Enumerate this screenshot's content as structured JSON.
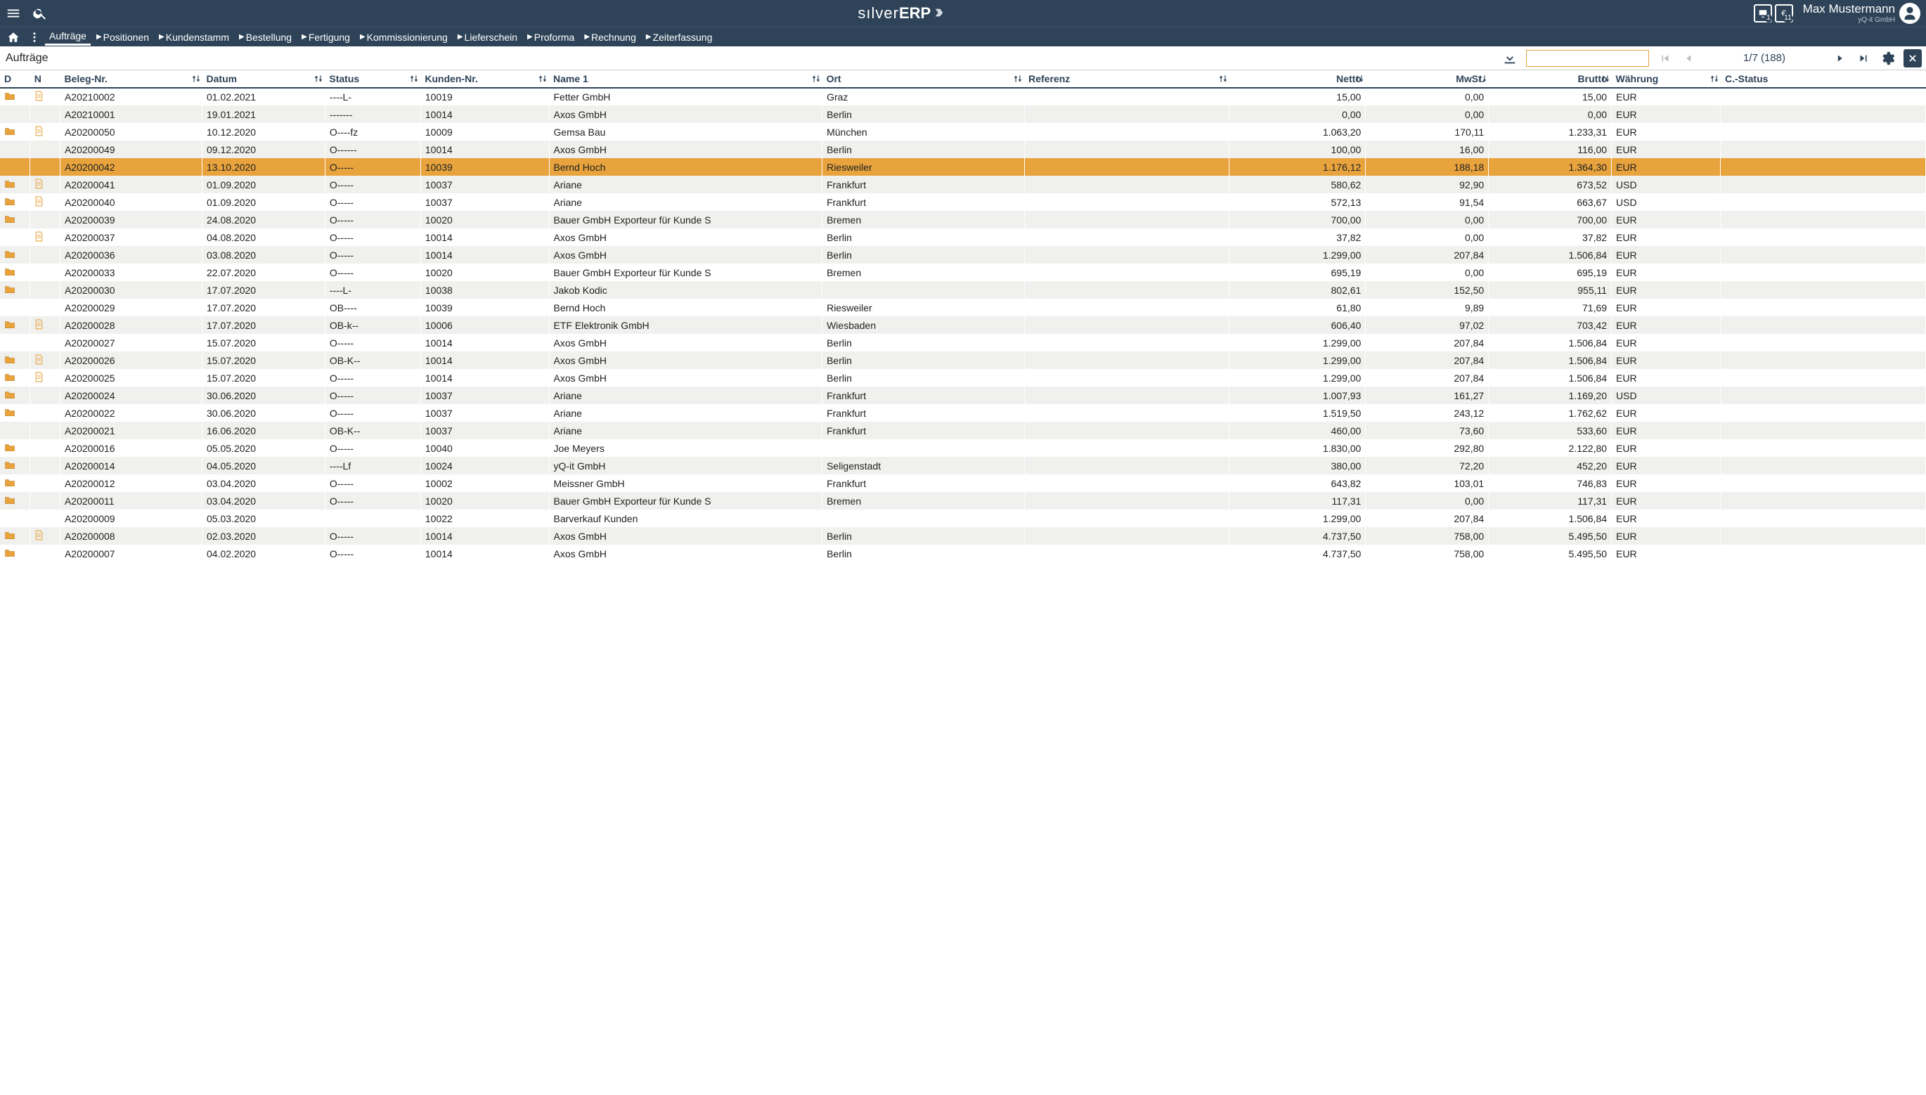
{
  "header": {
    "app_name_light": "sılver",
    "app_name_bold": "ERP",
    "badge1_count": "1",
    "badge2_count": "11",
    "user_name": "Max Mustermann",
    "user_company": "yQ-it GmbH"
  },
  "breadcrumb": {
    "items": [
      {
        "label": "Aufträge",
        "active": true,
        "caret": false
      },
      {
        "label": "Positionen",
        "active": false,
        "caret": true
      },
      {
        "label": "Kundenstamm",
        "active": false,
        "caret": true
      },
      {
        "label": "Bestellung",
        "active": false,
        "caret": true
      },
      {
        "label": "Fertigung",
        "active": false,
        "caret": true
      },
      {
        "label": "Kommissionierung",
        "active": false,
        "caret": true
      },
      {
        "label": "Lieferschein",
        "active": false,
        "caret": true
      },
      {
        "label": "Proforma",
        "active": false,
        "caret": true
      },
      {
        "label": "Rechnung",
        "active": false,
        "caret": true
      },
      {
        "label": "Zeiterfassung",
        "active": false,
        "caret": true
      }
    ]
  },
  "toolbar": {
    "title": "Aufträge",
    "search_value": "",
    "search_placeholder": "",
    "pager": "1/7 (188)"
  },
  "table": {
    "columns": [
      {
        "key": "d",
        "label": "D",
        "num": false,
        "sort": false
      },
      {
        "key": "n",
        "label": "N",
        "num": false,
        "sort": false
      },
      {
        "key": "beleg",
        "label": "Beleg-Nr.",
        "num": false,
        "sort": true
      },
      {
        "key": "datum",
        "label": "Datum",
        "num": false,
        "sort": true
      },
      {
        "key": "status",
        "label": "Status",
        "num": false,
        "sort": true
      },
      {
        "key": "kunden",
        "label": "Kunden-Nr.",
        "num": false,
        "sort": true
      },
      {
        "key": "name1",
        "label": "Name 1",
        "num": false,
        "sort": true
      },
      {
        "key": "ort",
        "label": "Ort",
        "num": false,
        "sort": true
      },
      {
        "key": "referenz",
        "label": "Referenz",
        "num": false,
        "sort": true
      },
      {
        "key": "netto",
        "label": "Netto",
        "num": true,
        "sort": true
      },
      {
        "key": "mwst",
        "label": "MwSt.",
        "num": true,
        "sort": true
      },
      {
        "key": "brutto",
        "label": "Brutto",
        "num": true,
        "sort": true
      },
      {
        "key": "wahrung",
        "label": "Währung",
        "num": false,
        "sort": true
      },
      {
        "key": "cstatus",
        "label": "C.-Status",
        "num": false,
        "sort": false
      }
    ],
    "rows": [
      {
        "d": "folder",
        "n": "page",
        "beleg": "A20210002",
        "datum": "01.02.2021",
        "status": "----L-",
        "kunden": "10019",
        "name1": "Fetter GmbH",
        "ort": "Graz",
        "referenz": "",
        "netto": "15,00",
        "mwst": "0,00",
        "brutto": "15,00",
        "wahrung": "EUR",
        "cstatus": "",
        "sel": false
      },
      {
        "d": "",
        "n": "",
        "beleg": "A20210001",
        "datum": "19.01.2021",
        "status": "-------",
        "kunden": "10014",
        "name1": "Axos GmbH",
        "ort": "Berlin",
        "referenz": "",
        "netto": "0,00",
        "mwst": "0,00",
        "brutto": "0,00",
        "wahrung": "EUR",
        "cstatus": "",
        "sel": false
      },
      {
        "d": "folder",
        "n": "page",
        "beleg": "A20200050",
        "datum": "10.12.2020",
        "status": "O----fz",
        "kunden": "10009",
        "name1": "Gemsa Bau",
        "ort": "München",
        "referenz": "",
        "netto": "1.063,20",
        "mwst": "170,11",
        "brutto": "1.233,31",
        "wahrung": "EUR",
        "cstatus": "",
        "sel": false
      },
      {
        "d": "",
        "n": "",
        "beleg": "A20200049",
        "datum": "09.12.2020",
        "status": "O------",
        "kunden": "10014",
        "name1": "Axos GmbH",
        "ort": "Berlin",
        "referenz": "",
        "netto": "100,00",
        "mwst": "16,00",
        "brutto": "116,00",
        "wahrung": "EUR",
        "cstatus": "",
        "sel": false
      },
      {
        "d": "",
        "n": "",
        "beleg": "A20200042",
        "datum": "13.10.2020",
        "status": "O-----",
        "kunden": "10039",
        "name1": "Bernd Hoch",
        "ort": "Riesweiler",
        "referenz": "",
        "netto": "1.176,12",
        "mwst": "188,18",
        "brutto": "1.364,30",
        "wahrung": "EUR",
        "cstatus": "",
        "sel": true
      },
      {
        "d": "folder",
        "n": "page",
        "beleg": "A20200041",
        "datum": "01.09.2020",
        "status": "O-----",
        "kunden": "10037",
        "name1": "Ariane",
        "ort": "Frankfurt",
        "referenz": "",
        "netto": "580,62",
        "mwst": "92,90",
        "brutto": "673,52",
        "wahrung": "USD",
        "cstatus": "",
        "sel": false
      },
      {
        "d": "folder",
        "n": "page",
        "beleg": "A20200040",
        "datum": "01.09.2020",
        "status": "O-----",
        "kunden": "10037",
        "name1": "Ariane",
        "ort": "Frankfurt",
        "referenz": "",
        "netto": "572,13",
        "mwst": "91,54",
        "brutto": "663,67",
        "wahrung": "USD",
        "cstatus": "",
        "sel": false
      },
      {
        "d": "folder",
        "n": "",
        "beleg": "A20200039",
        "datum": "24.08.2020",
        "status": "O-----",
        "kunden": "10020",
        "name1": "Bauer GmbH Exporteur für Kunde S",
        "ort": "Bremen",
        "referenz": "",
        "netto": "700,00",
        "mwst": "0,00",
        "brutto": "700,00",
        "wahrung": "EUR",
        "cstatus": "",
        "sel": false
      },
      {
        "d": "",
        "n": "page",
        "beleg": "A20200037",
        "datum": "04.08.2020",
        "status": "O-----",
        "kunden": "10014",
        "name1": "Axos GmbH",
        "ort": "Berlin",
        "referenz": "",
        "netto": "37,82",
        "mwst": "0,00",
        "brutto": "37,82",
        "wahrung": "EUR",
        "cstatus": "",
        "sel": false
      },
      {
        "d": "folder",
        "n": "",
        "beleg": "A20200036",
        "datum": "03.08.2020",
        "status": "O-----",
        "kunden": "10014",
        "name1": "Axos GmbH",
        "ort": "Berlin",
        "referenz": "",
        "netto": "1.299,00",
        "mwst": "207,84",
        "brutto": "1.506,84",
        "wahrung": "EUR",
        "cstatus": "",
        "sel": false
      },
      {
        "d": "folder",
        "n": "",
        "beleg": "A20200033",
        "datum": "22.07.2020",
        "status": "O-----",
        "kunden": "10020",
        "name1": "Bauer GmbH Exporteur für Kunde S",
        "ort": "Bremen",
        "referenz": "",
        "netto": "695,19",
        "mwst": "0,00",
        "brutto": "695,19",
        "wahrung": "EUR",
        "cstatus": "",
        "sel": false
      },
      {
        "d": "folder",
        "n": "",
        "beleg": "A20200030",
        "datum": "17.07.2020",
        "status": "----L-",
        "kunden": "10038",
        "name1": "Jakob Kodic",
        "ort": "",
        "referenz": "",
        "netto": "802,61",
        "mwst": "152,50",
        "brutto": "955,11",
        "wahrung": "EUR",
        "cstatus": "",
        "sel": false
      },
      {
        "d": "",
        "n": "",
        "beleg": "A20200029",
        "datum": "17.07.2020",
        "status": "OB----",
        "kunden": "10039",
        "name1": "Bernd Hoch",
        "ort": "Riesweiler",
        "referenz": "",
        "netto": "61,80",
        "mwst": "9,89",
        "brutto": "71,69",
        "wahrung": "EUR",
        "cstatus": "",
        "sel": false
      },
      {
        "d": "folder",
        "n": "page",
        "beleg": "A20200028",
        "datum": "17.07.2020",
        "status": "OB-k--",
        "kunden": "10006",
        "name1": "ETF Elektronik GmbH",
        "ort": "Wiesbaden",
        "referenz": "",
        "netto": "606,40",
        "mwst": "97,02",
        "brutto": "703,42",
        "wahrung": "EUR",
        "cstatus": "",
        "sel": false
      },
      {
        "d": "",
        "n": "",
        "beleg": "A20200027",
        "datum": "15.07.2020",
        "status": "O-----",
        "kunden": "10014",
        "name1": "Axos GmbH",
        "ort": "Berlin",
        "referenz": "",
        "netto": "1.299,00",
        "mwst": "207,84",
        "brutto": "1.506,84",
        "wahrung": "EUR",
        "cstatus": "",
        "sel": false
      },
      {
        "d": "folder",
        "n": "page",
        "beleg": "A20200026",
        "datum": "15.07.2020",
        "status": "OB-K--",
        "kunden": "10014",
        "name1": "Axos GmbH",
        "ort": "Berlin",
        "referenz": "",
        "netto": "1.299,00",
        "mwst": "207,84",
        "brutto": "1.506,84",
        "wahrung": "EUR",
        "cstatus": "",
        "sel": false
      },
      {
        "d": "folder",
        "n": "page",
        "beleg": "A20200025",
        "datum": "15.07.2020",
        "status": "O-----",
        "kunden": "10014",
        "name1": "Axos GmbH",
        "ort": "Berlin",
        "referenz": "",
        "netto": "1.299,00",
        "mwst": "207,84",
        "brutto": "1.506,84",
        "wahrung": "EUR",
        "cstatus": "",
        "sel": false
      },
      {
        "d": "folder",
        "n": "",
        "beleg": "A20200024",
        "datum": "30.06.2020",
        "status": "O-----",
        "kunden": "10037",
        "name1": "Ariane",
        "ort": "Frankfurt",
        "referenz": "",
        "netto": "1.007,93",
        "mwst": "161,27",
        "brutto": "1.169,20",
        "wahrung": "USD",
        "cstatus": "",
        "sel": false
      },
      {
        "d": "folder",
        "n": "",
        "beleg": "A20200022",
        "datum": "30.06.2020",
        "status": "O-----",
        "kunden": "10037",
        "name1": "Ariane",
        "ort": "Frankfurt",
        "referenz": "",
        "netto": "1.519,50",
        "mwst": "243,12",
        "brutto": "1.762,62",
        "wahrung": "EUR",
        "cstatus": "",
        "sel": false
      },
      {
        "d": "",
        "n": "",
        "beleg": "A20200021",
        "datum": "16.06.2020",
        "status": "OB-K--",
        "kunden": "10037",
        "name1": "Ariane",
        "ort": "Frankfurt",
        "referenz": "",
        "netto": "460,00",
        "mwst": "73,60",
        "brutto": "533,60",
        "wahrung": "EUR",
        "cstatus": "",
        "sel": false
      },
      {
        "d": "folder",
        "n": "",
        "beleg": "A20200016",
        "datum": "05.05.2020",
        "status": "O-----",
        "kunden": "10040",
        "name1": "Joe Meyers",
        "ort": "",
        "referenz": "",
        "netto": "1.830,00",
        "mwst": "292,80",
        "brutto": "2.122,80",
        "wahrung": "EUR",
        "cstatus": "",
        "sel": false
      },
      {
        "d": "folder",
        "n": "",
        "beleg": "A20200014",
        "datum": "04.05.2020",
        "status": "----Lf",
        "kunden": "10024",
        "name1": "yQ-it GmbH",
        "ort": "Seligenstadt",
        "referenz": "",
        "netto": "380,00",
        "mwst": "72,20",
        "brutto": "452,20",
        "wahrung": "EUR",
        "cstatus": "",
        "sel": false
      },
      {
        "d": "folder",
        "n": "",
        "beleg": "A20200012",
        "datum": "03.04.2020",
        "status": "O-----",
        "kunden": "10002",
        "name1": "Meissner GmbH",
        "ort": "Frankfurt",
        "referenz": "",
        "netto": "643,82",
        "mwst": "103,01",
        "brutto": "746,83",
        "wahrung": "EUR",
        "cstatus": "",
        "sel": false
      },
      {
        "d": "folder",
        "n": "",
        "beleg": "A20200011",
        "datum": "03.04.2020",
        "status": "O-----",
        "kunden": "10020",
        "name1": "Bauer GmbH Exporteur für Kunde S",
        "ort": "Bremen",
        "referenz": "",
        "netto": "117,31",
        "mwst": "0,00",
        "brutto": "117,31",
        "wahrung": "EUR",
        "cstatus": "",
        "sel": false
      },
      {
        "d": "",
        "n": "",
        "beleg": "A20200009",
        "datum": "05.03.2020",
        "status": "",
        "kunden": "10022",
        "name1": "Barverkauf Kunden",
        "ort": "",
        "referenz": "",
        "netto": "1.299,00",
        "mwst": "207,84",
        "brutto": "1.506,84",
        "wahrung": "EUR",
        "cstatus": "",
        "sel": false
      },
      {
        "d": "folder",
        "n": "page",
        "beleg": "A20200008",
        "datum": "02.03.2020",
        "status": "O-----",
        "kunden": "10014",
        "name1": "Axos GmbH",
        "ort": "Berlin",
        "referenz": "",
        "netto": "4.737,50",
        "mwst": "758,00",
        "brutto": "5.495,50",
        "wahrung": "EUR",
        "cstatus": "",
        "sel": false
      },
      {
        "d": "folder",
        "n": "",
        "beleg": "A20200007",
        "datum": "04.02.2020",
        "status": "O-----",
        "kunden": "10014",
        "name1": "Axos GmbH",
        "ort": "Berlin",
        "referenz": "",
        "netto": "4.737,50",
        "mwst": "758,00",
        "brutto": "5.495,50",
        "wahrung": "EUR",
        "cstatus": "",
        "sel": false
      }
    ]
  }
}
